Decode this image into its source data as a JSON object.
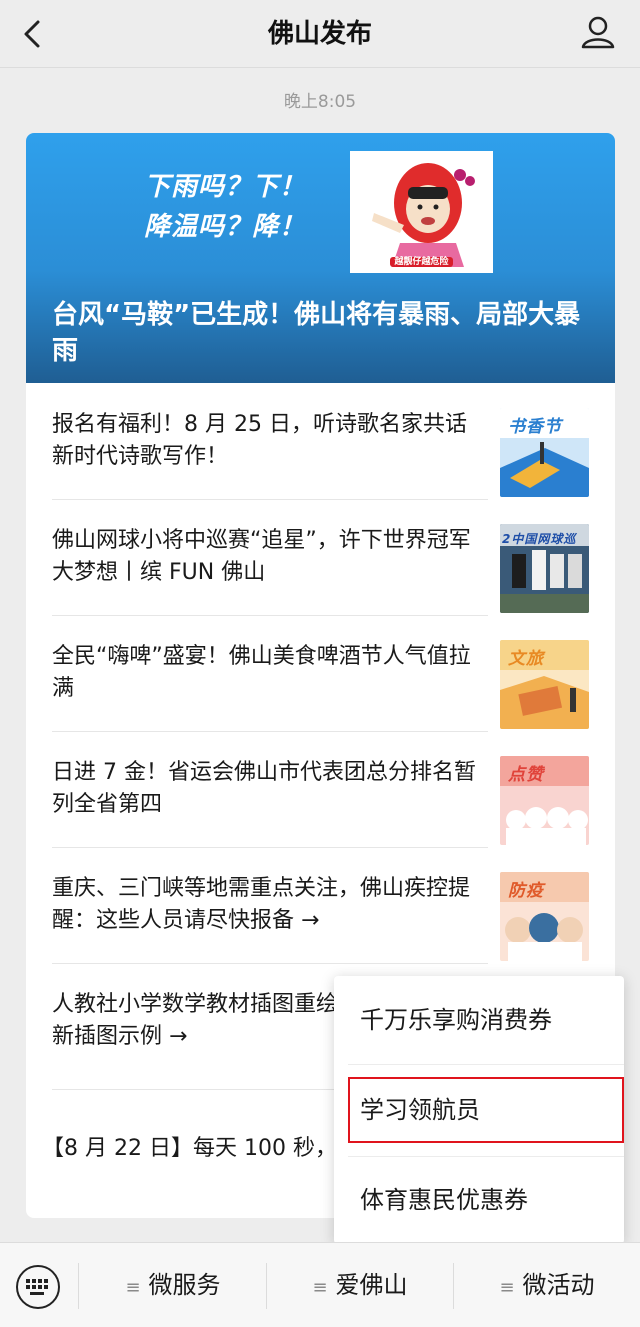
{
  "header": {
    "title": "佛山发布",
    "back_icon": "chevron-left-icon",
    "profile_icon": "user-icon"
  },
  "timestamp": "晚上8:05",
  "banner": {
    "slogan_line1": "下雨吗？下！",
    "slogan_line2": "降温吗？降！",
    "sticker_caption": "越靓仔越危险",
    "title": "台风“马鞍”已生成！佛山将有暴雨、局部大暴雨"
  },
  "articles": [
    {
      "title": "报名有福利！8 月 25 日，听诗歌名家共话新时代诗歌写作！",
      "thumb_label": "书香节",
      "thumb_color": "#2a7fd0"
    },
    {
      "title": "佛山网球小将中巡赛“追星”，许下世界冠军大梦想丨缤 FUN 佛山",
      "thumb_label": "2中国网球巡",
      "thumb_color": "#d8d8d8"
    },
    {
      "title": "全民“嗨啤”盛宴！佛山美食啤酒节人气值拉满",
      "thumb_label": "文旅",
      "thumb_color": "#e88a24"
    },
    {
      "title": "日进 7 金！省运会佛山市代表团总分排名暂列全省第四",
      "thumb_label": "点赞",
      "thumb_color": "#e0433a"
    },
    {
      "title": "重庆、三门峡等地需重点关注，佛山疾控提醒：这些人员请尽快报备 →",
      "thumb_label": "防疫",
      "thumb_color": "#e05a2a"
    },
    {
      "title": "人教社小学数学教材插图重绘工作基本完成，新插图示例 →"
    }
  ],
  "last_item_text": "【8 月 22 日】每天 100 秒，全",
  "popup_menu": {
    "items": [
      "千万乐享购消费券",
      "学习领航员",
      "体育惠民优惠券"
    ],
    "highlight_color": "#e0141d"
  },
  "bottom_bar": {
    "keyboard_icon": "keyboard-icon",
    "menu_icon": "menu-lines-icon",
    "tabs": [
      "微服务",
      "爱佛山",
      "微活动"
    ]
  }
}
